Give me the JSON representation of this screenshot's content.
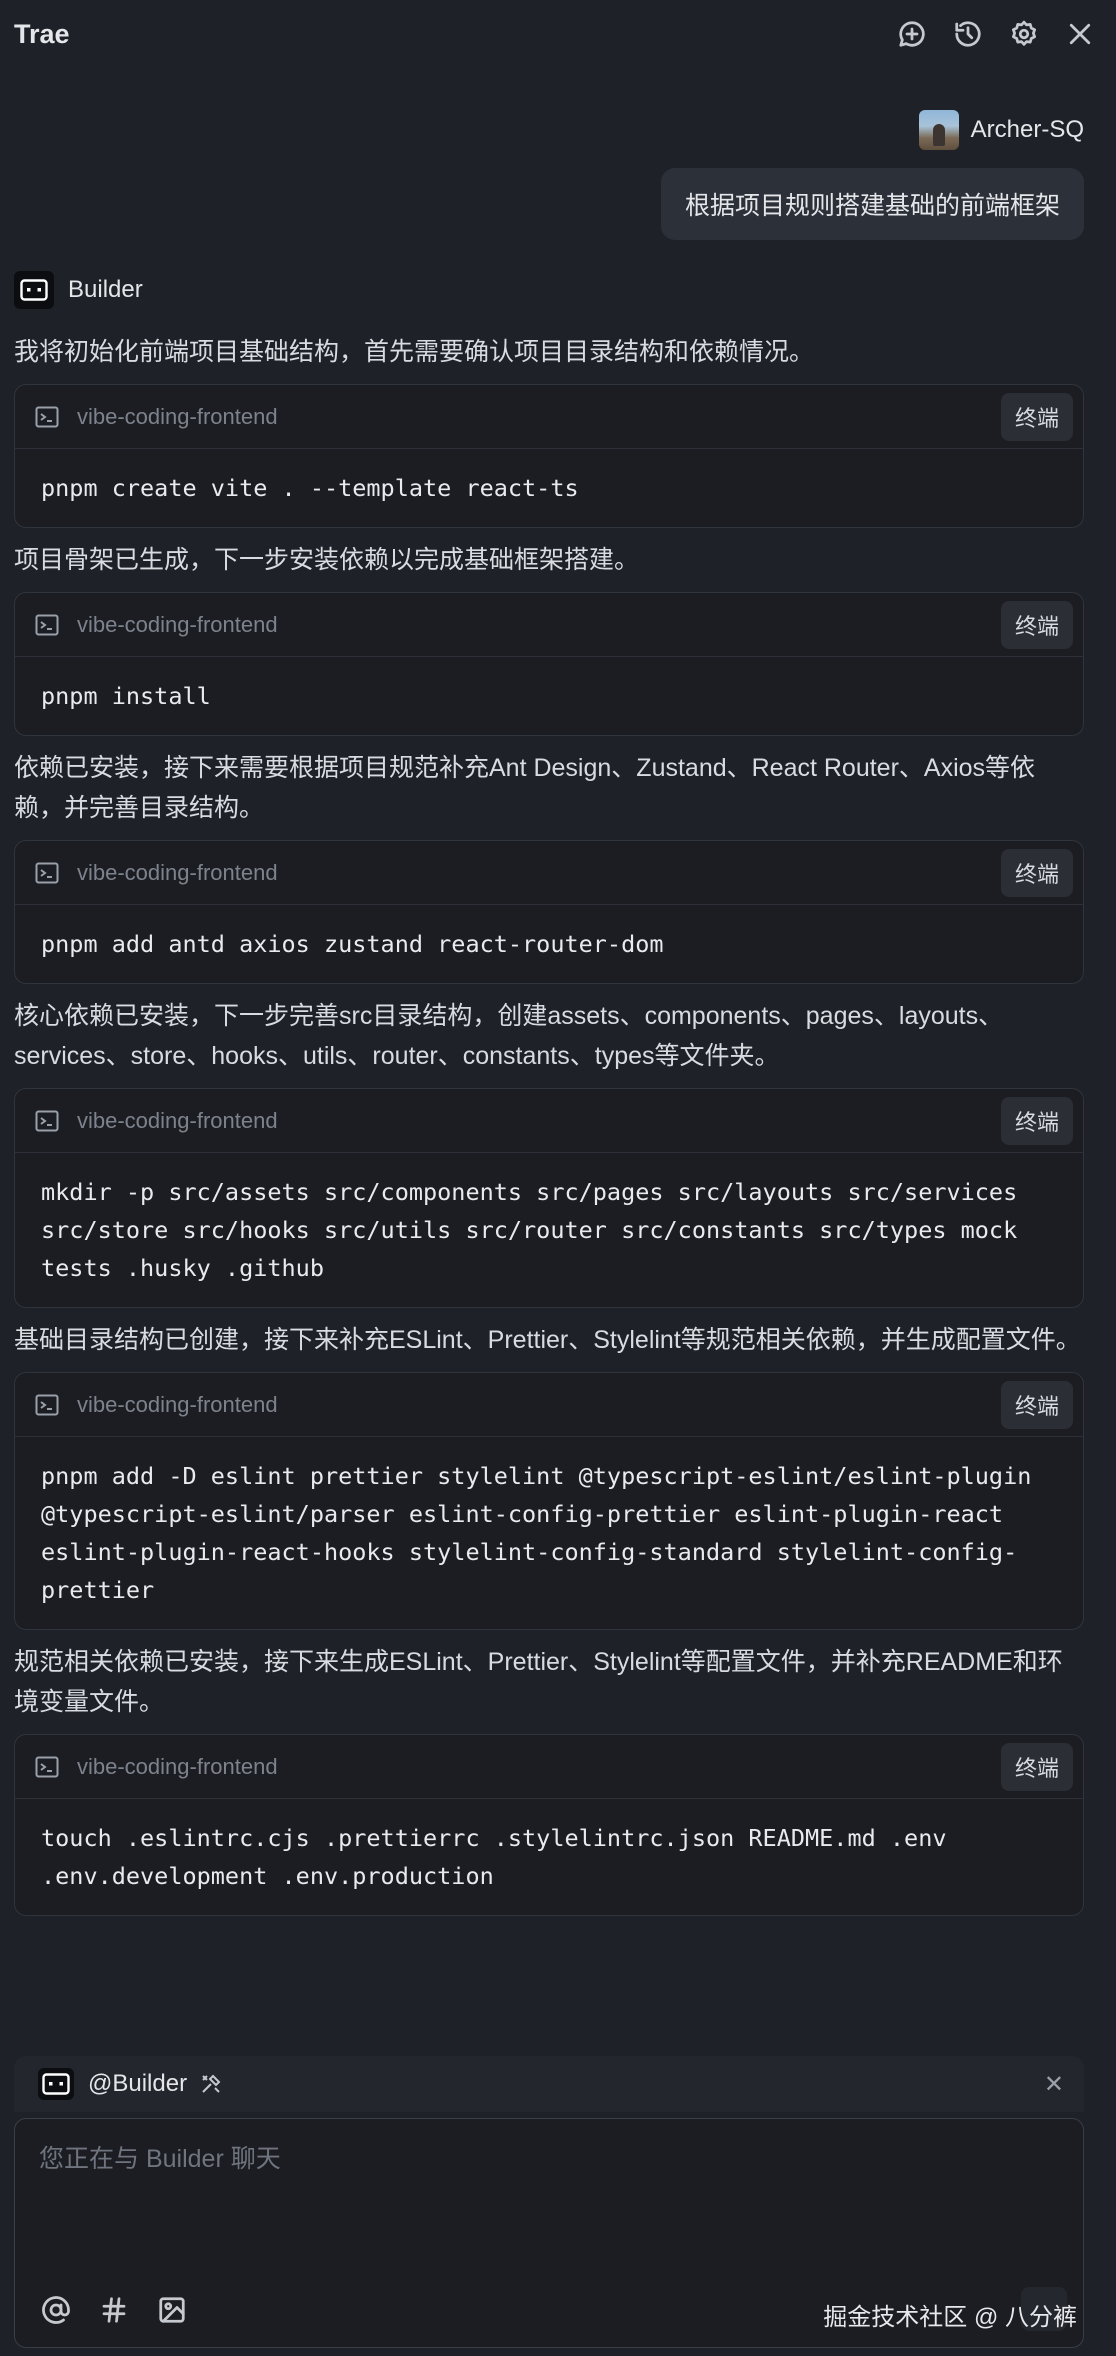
{
  "app": {
    "title": "Trae"
  },
  "header": {
    "icons": [
      "new-chat-icon",
      "history-icon",
      "settings-icon",
      "close-icon"
    ]
  },
  "user": {
    "name": "Archer-SQ",
    "message": "根据项目规则搭建基础的前端框架"
  },
  "assistant": {
    "name": "Builder",
    "blocks": [
      {
        "text": "我将初始化前端项目基础结构，首先需要确认项目目录结构和依赖情况。",
        "cwd": "vibe-coding-frontend",
        "button": "终端",
        "command": "pnpm create vite . --template react-ts"
      },
      {
        "text": "项目骨架已生成，下一步安装依赖以完成基础框架搭建。",
        "cwd": "vibe-coding-frontend",
        "button": "终端",
        "command": "pnpm install"
      },
      {
        "text": "依赖已安装，接下来需要根据项目规范补充Ant Design、Zustand、React Router、Axios等依赖，并完善目录结构。",
        "cwd": "vibe-coding-frontend",
        "button": "终端",
        "command": "pnpm add antd axios zustand react-router-dom"
      },
      {
        "text": "核心依赖已安装，下一步完善src目录结构，创建assets、components、pages、layouts、services、store、hooks、utils、router、constants、types等文件夹。",
        "cwd": "vibe-coding-frontend",
        "button": "终端",
        "command": "mkdir -p src/assets src/components src/pages src/layouts src/services\nsrc/store src/hooks src/utils src/router src/constants src/types mock\ntests .husky .github"
      },
      {
        "text": "基础目录结构已创建，接下来补充ESLint、Prettier、Stylelint等规范相关依赖，并生成配置文件。",
        "cwd": "vibe-coding-frontend",
        "button": "终端",
        "command": "pnpm add -D eslint prettier stylelint @typescript-eslint/eslint-plugin\n@typescript-eslint/parser eslint-config-prettier eslint-plugin-react\neslint-plugin-react-hooks stylelint-config-standard stylelint-config-\nprettier"
      },
      {
        "text": "规范相关依赖已安装，接下来生成ESLint、Prettier、Stylelint等配置文件，并补充README和环境变量文件。",
        "cwd": "vibe-coding-frontend",
        "button": "终端",
        "command": "touch .eslintrc.cjs .prettierrc .stylelintrc.json README.md .env\n.env.development .env.production"
      }
    ]
  },
  "composer": {
    "mention": "@Builder",
    "placeholder": "您正在与 Builder 聊天",
    "value": "",
    "tools": [
      "at-icon",
      "hash-icon",
      "image-icon"
    ],
    "watermark": "掘金技术社区 @ 八分裤"
  }
}
